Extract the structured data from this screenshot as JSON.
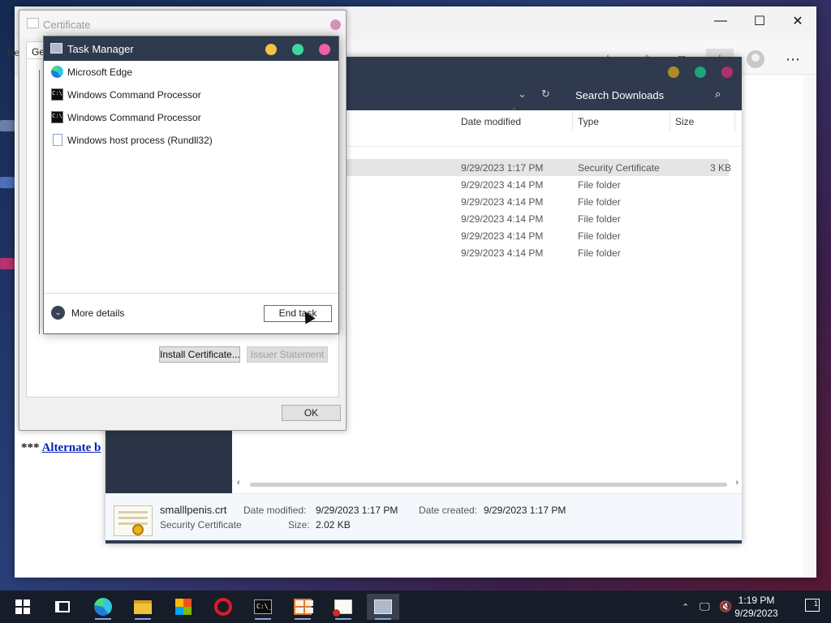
{
  "browser": {
    "window_controls": {
      "minimize": "—",
      "maximize": "☐",
      "close": "✕"
    },
    "edge_text": "Re",
    "page_line_prefix": "*** ",
    "page_link": "Alternate b",
    "toolbar_icons": [
      "favorites-star-icon",
      "collections-icon",
      "extensions-icon",
      "downloads-icon",
      "profile-avatar-icon",
      "more-menu-icon"
    ]
  },
  "explorer": {
    "search_label": "Search Downloads",
    "columns": [
      "Date modified",
      "Type",
      "Size"
    ],
    "rows": [
      {
        "date": "9/29/2023 1:17 PM",
        "type": "Security Certificate",
        "size": "3 KB",
        "selected": true
      },
      {
        "date": "9/29/2023 4:14 PM",
        "type": "File folder",
        "size": ""
      },
      {
        "date": "9/29/2023 4:14 PM",
        "type": "File folder",
        "size": ""
      },
      {
        "date": "9/29/2023 4:14 PM",
        "type": "File folder",
        "size": ""
      },
      {
        "date": "9/29/2023 4:14 PM",
        "type": "File folder",
        "size": ""
      },
      {
        "date": "9/29/2023 4:14 PM",
        "type": "File folder",
        "size": ""
      }
    ],
    "details": {
      "file_name": "smalllpenis.crt",
      "file_type": "Security Certificate",
      "date_modified_label": "Date modified:",
      "date_modified": "9/29/2023 1:17 PM",
      "date_created_label": "Date created:",
      "date_created": "9/29/2023 1:17 PM",
      "size_label": "Size:",
      "size": "2.02 KB"
    },
    "dot_colors": [
      "#b08a2a",
      "#1fa37a",
      "#b0306a"
    ]
  },
  "certificate_dialog": {
    "title": "Certificate",
    "tab_label": "Ger",
    "install_button": "Install Certificate...",
    "issuer_button": "Issuer Statement",
    "ok_button": "OK"
  },
  "task_manager": {
    "title": "Task Manager",
    "dot_colors": [
      "#f5c242",
      "#3ed7a0",
      "#ef5fa4"
    ],
    "apps": [
      {
        "name": "Microsoft Edge",
        "icon": "edge-icon"
      },
      {
        "name": "Windows Command Processor",
        "icon": "cmd-icon"
      },
      {
        "name": "Windows Command Processor",
        "icon": "cmd-icon"
      },
      {
        "name": "Windows host process (Rundll32)",
        "icon": "document-icon"
      }
    ],
    "more_details": "More details",
    "end_task_button": "End task"
  },
  "taskbar": {
    "apps": [
      "start-icon",
      "task-view-icon",
      "edge-icon",
      "file-explorer-icon",
      "store-icon",
      "opera-icon",
      "cmd-icon",
      "app-window-icon",
      "certificate-icon",
      "task-manager-icon"
    ],
    "time": "1:19 PM",
    "date": "9/29/2023",
    "notification_count": "1"
  }
}
